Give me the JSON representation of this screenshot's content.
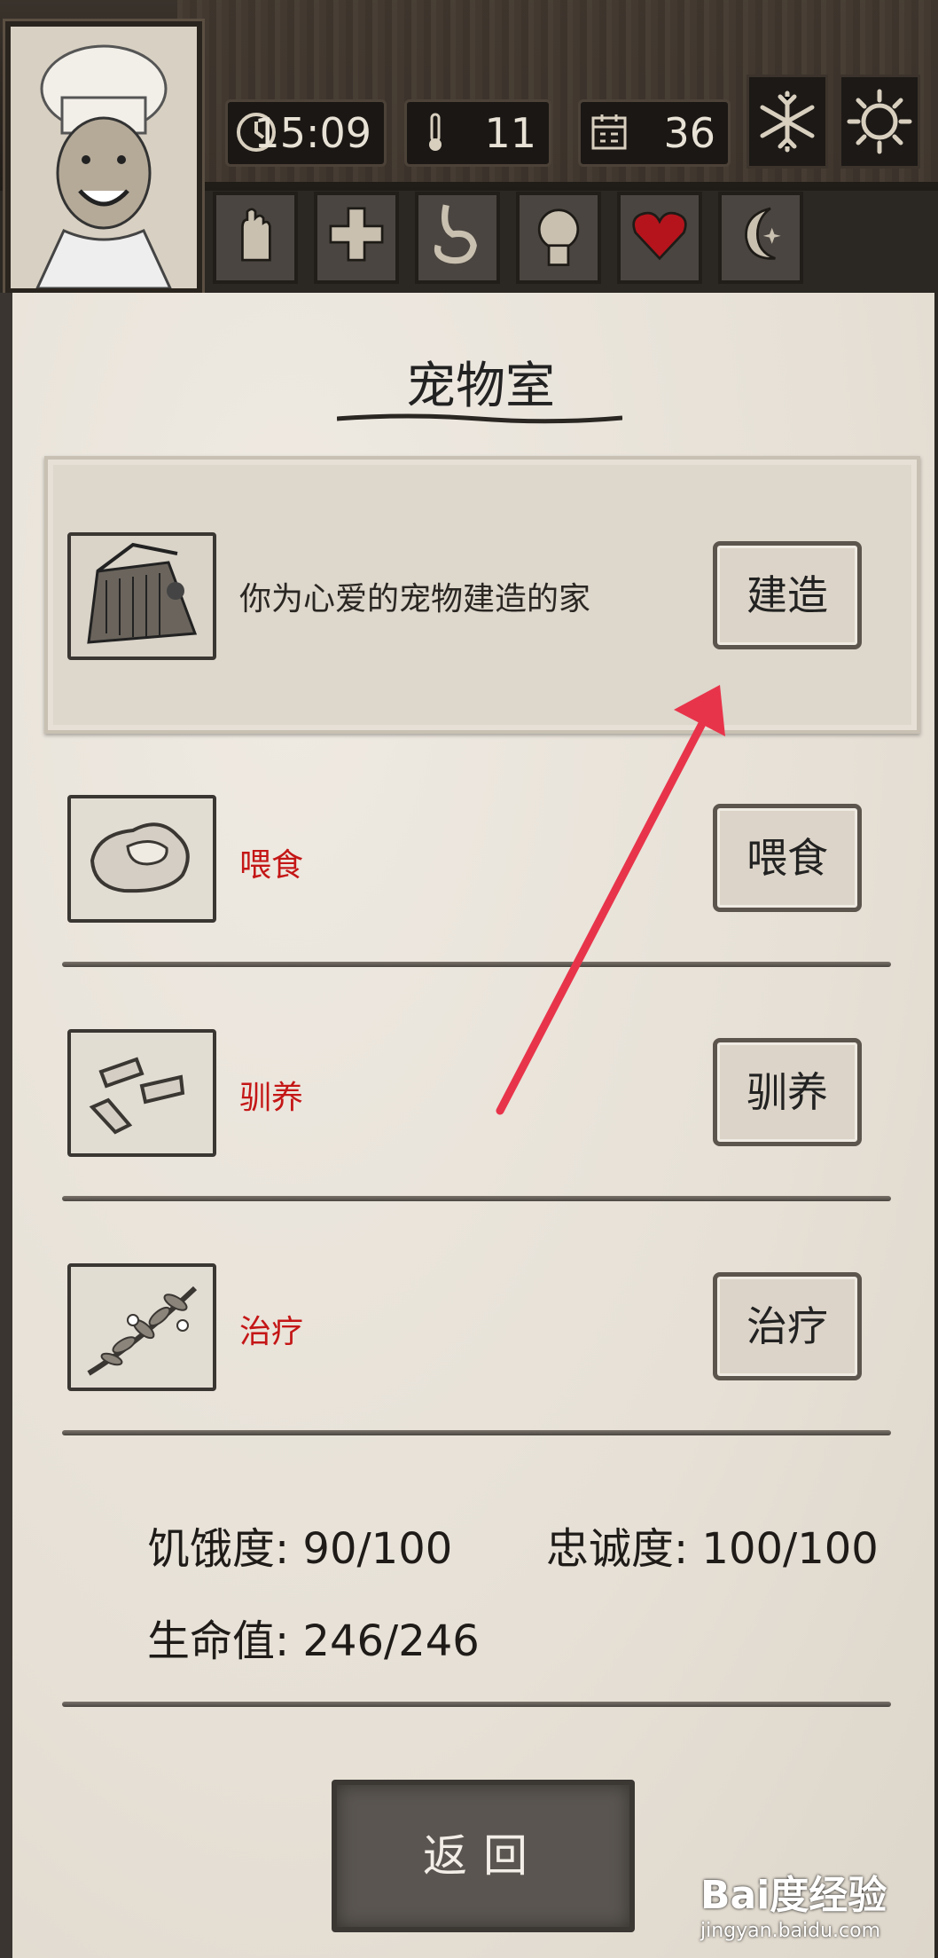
{
  "hud": {
    "time": "15:09",
    "temperature": "11",
    "day": "36",
    "icons": {
      "clock": "clock-icon",
      "thermometer": "thermometer-icon",
      "calendar": "calendar-icon",
      "snowflake": "snowflake-icon",
      "sun": "sun-icon"
    }
  },
  "tabs": [
    "hand-icon",
    "cross-icon",
    "stomach-icon",
    "head-icon",
    "heart-icon",
    "moon-icon"
  ],
  "page": {
    "title": "宠物室"
  },
  "items": [
    {
      "description": "你为心爱的宠物建造的家",
      "button": "建造",
      "thumb_icon": "pet-house-icon"
    },
    {
      "description": "喂食",
      "button": "喂食",
      "thumb_icon": "meat-icon"
    },
    {
      "description": "驯养",
      "button": "驯养",
      "thumb_icon": "meat-strips-icon"
    },
    {
      "description": "治疗",
      "button": "治疗",
      "thumb_icon": "herb-icon"
    }
  ],
  "pet_stats": {
    "hunger": "饥饿度: 90/100",
    "loyalty": "忠诚度: 100/100",
    "health": "生命值: 246/246"
  },
  "back_button": "返回",
  "watermark": {
    "brand": "Bai度经验",
    "url": "jingyan.baidu.com"
  },
  "colors": {
    "accent_red": "#c41616",
    "annotation_arrow": "#e8344a"
  }
}
